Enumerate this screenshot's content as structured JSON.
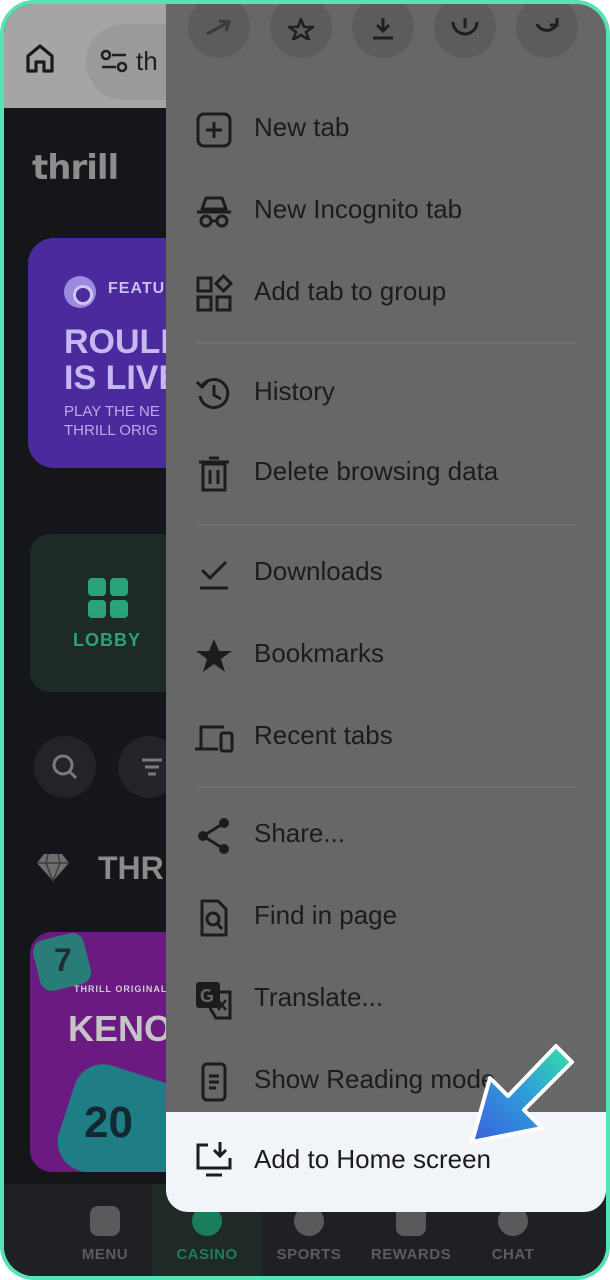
{
  "browser": {
    "url_text": "th"
  },
  "page": {
    "logo": "thrill",
    "promo": {
      "tag": "FEATU",
      "title_line1": "ROULE",
      "title_line2": "IS LIVE",
      "sub_line1": "PLAY THE NE",
      "sub_line2": "THRILL ORIG"
    },
    "lobby_label": "LOBBY",
    "section_title": "THR",
    "keno": {
      "ball_number": "7",
      "tag": "THRILL ORIGINALS",
      "title": "KENO",
      "ball_number_2": "20"
    }
  },
  "bottom_nav": [
    {
      "label": "MENU",
      "icon": "menu-icon"
    },
    {
      "label": "CASINO",
      "icon": "casino-icon",
      "active": true
    },
    {
      "label": "SPORTS",
      "icon": "sports-icon"
    },
    {
      "label": "REWARDS",
      "icon": "rewards-icon"
    },
    {
      "label": "CHAT",
      "icon": "chat-icon"
    }
  ],
  "menu": {
    "top_actions": [
      "forward-icon",
      "bookmark-star-icon",
      "download-icon",
      "info-icon",
      "refresh-icon"
    ],
    "items": [
      {
        "label": "New tab",
        "icon": "new-tab-icon"
      },
      {
        "label": "New Incognito tab",
        "icon": "incognito-icon"
      },
      {
        "label": "Add tab to group",
        "icon": "tab-group-icon"
      },
      {
        "label": "History",
        "icon": "history-icon"
      },
      {
        "label": "Delete browsing data",
        "icon": "trash-icon"
      },
      {
        "label": "Downloads",
        "icon": "downloads-icon"
      },
      {
        "label": "Bookmarks",
        "icon": "star-icon"
      },
      {
        "label": "Recent tabs",
        "icon": "devices-icon"
      },
      {
        "label": "Share...",
        "icon": "share-icon"
      },
      {
        "label": "Find in page",
        "icon": "find-icon"
      },
      {
        "label": "Translate...",
        "icon": "translate-icon"
      },
      {
        "label": "Show Reading mode",
        "icon": "reading-mode-icon"
      },
      {
        "label": "Add to Home screen",
        "icon": "add-home-screen-icon",
        "highlighted": true
      }
    ]
  },
  "colors": {
    "frame_accent": "#55e2b6",
    "menu_highlight": "#f1f4f8",
    "casino_green": "#2aa27a",
    "arrow_pointer": "#2f7bdc"
  }
}
